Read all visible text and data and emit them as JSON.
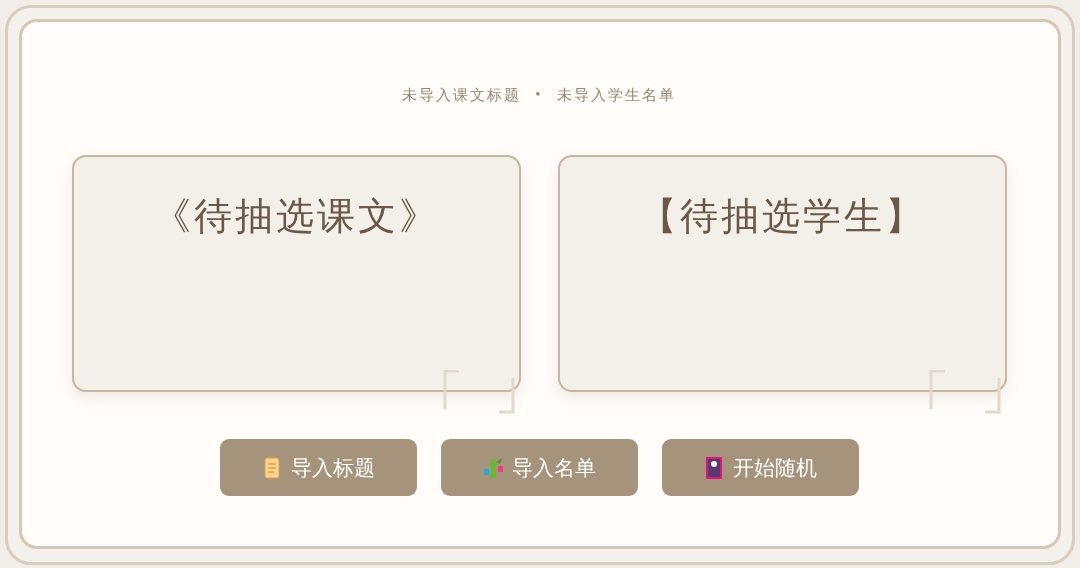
{
  "status": {
    "items": [
      "未导入课文标题",
      "未导入学生名单"
    ],
    "separator": "•"
  },
  "cards": [
    {
      "title": "《待抽选课文》"
    },
    {
      "title": "【待抽选学生】"
    }
  ],
  "buttons": [
    {
      "label": "导入标题",
      "kind": "scroll"
    },
    {
      "label": "导入名单",
      "kind": "bamboo"
    },
    {
      "label": "开始随机",
      "kind": "card"
    }
  ]
}
